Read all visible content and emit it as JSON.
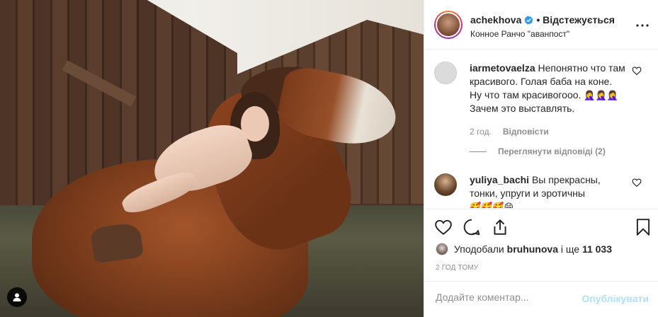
{
  "post": {
    "username": "achekhova",
    "follow_label": "• Відстежується",
    "location": "Конное Ранчо \"аванпост\""
  },
  "comments": [
    {
      "username": "iarmetovaelza",
      "text": "Непонятно что там красивого. Голая баба на коне. Ну что там красивогооо.",
      "emoji": "🤦‍♀️🤦‍♀️🤦‍♀️",
      "text_after": "Зачем это выставлять.",
      "time": "2 год.",
      "reply_label": "Відповісти",
      "replies_label": "Переглянути відповіді (2)"
    },
    {
      "username": "yuliya_bachi",
      "text": "Вы прекрасны, тонки, упруги и эротичны",
      "emoji": "🥰🥰🥰😁"
    }
  ],
  "likes": {
    "prefix": "Уподобали",
    "user": "bruhunova",
    "middle": "і ще",
    "count": "11 033"
  },
  "time_ago": "2 ГОД ТОМУ",
  "add_comment": {
    "placeholder": "Додайте коментар...",
    "publish_label": "Опублікувати"
  }
}
